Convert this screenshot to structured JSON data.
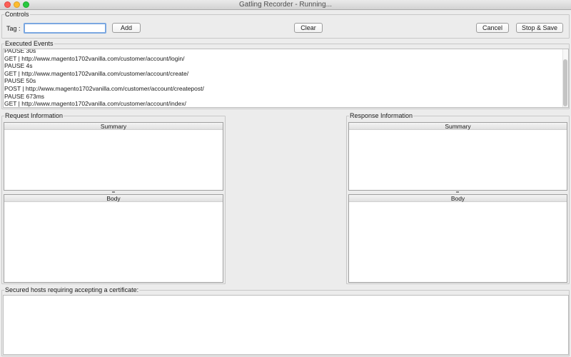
{
  "window": {
    "title": "Gatling Recorder - Running..."
  },
  "controls": {
    "group_label": "Controls",
    "tag_label": "Tag :",
    "tag_value": "",
    "add_label": "Add",
    "clear_label": "Clear",
    "cancel_label": "Cancel",
    "stop_save_label": "Stop & Save"
  },
  "events": {
    "group_label": "Executed Events",
    "items": [
      "PAUSE 30s",
      "GET | http://www.magento1702vanilla.com/customer/account/login/",
      "PAUSE 4s",
      "GET | http://www.magento1702vanilla.com/customer/account/create/",
      "PAUSE 50s",
      "POST | http://www.magento1702vanilla.com/customer/account/createpost/",
      "PAUSE 673ms",
      "GET | http://www.magento1702vanilla.com/customer/account/index/"
    ]
  },
  "request": {
    "group_label": "Request Information",
    "summary_header": "Summary",
    "body_header": "Body"
  },
  "response": {
    "group_label": "Response Information",
    "summary_header": "Summary",
    "body_header": "Body"
  },
  "certs": {
    "group_label": "Secured hosts requiring accepting a certificate:"
  }
}
